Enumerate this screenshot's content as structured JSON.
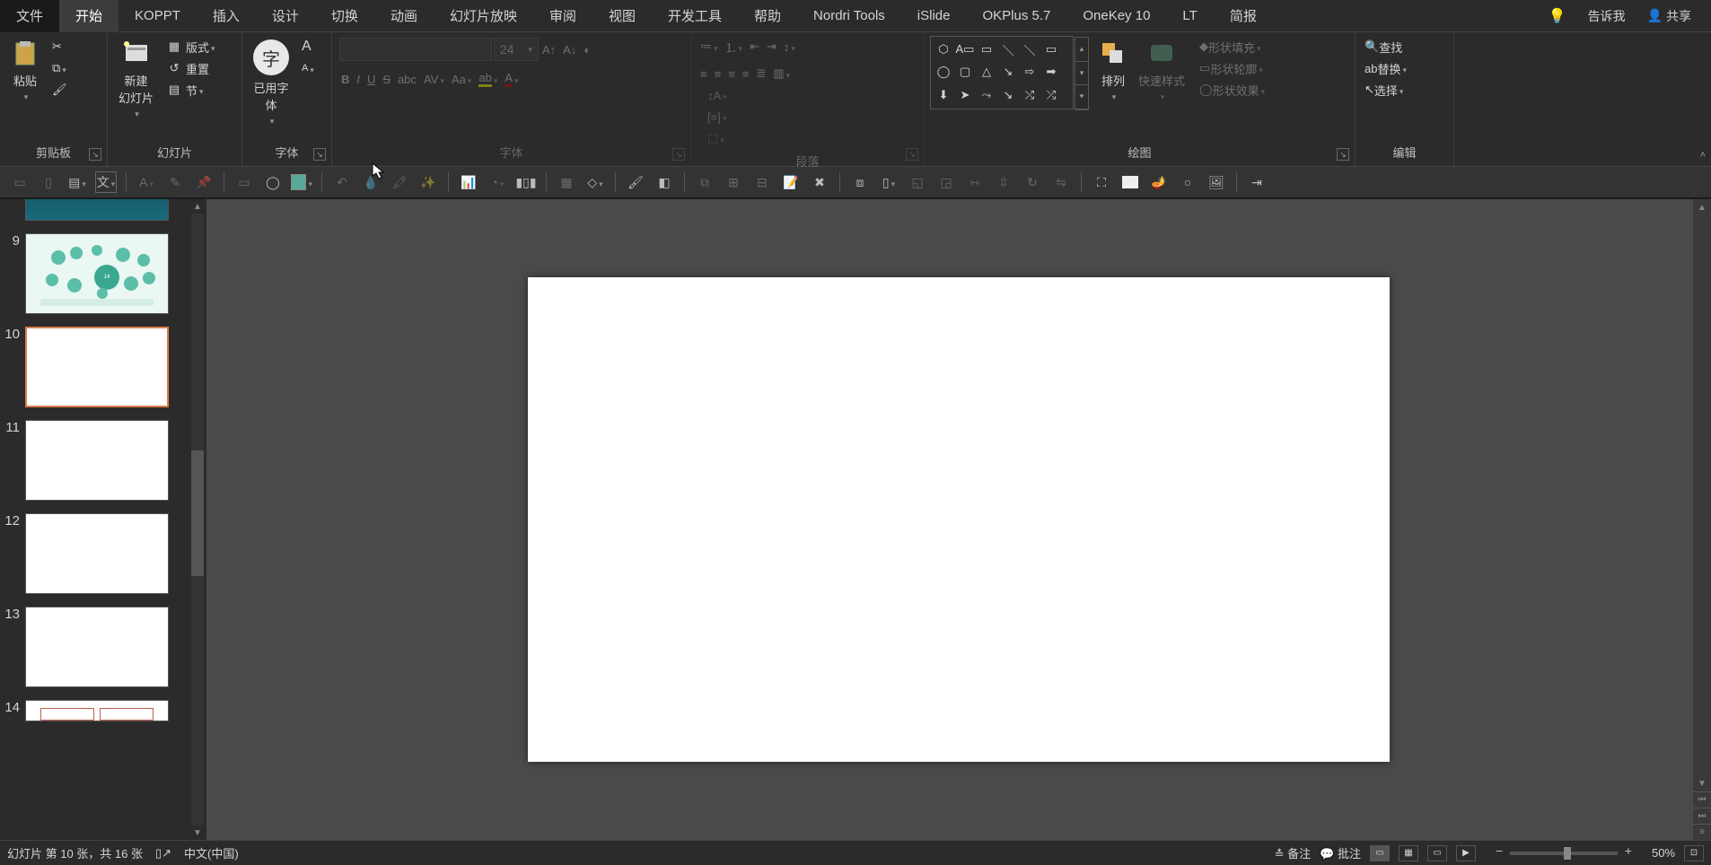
{
  "menu": {
    "file": "文件",
    "home": "开始",
    "tabs": [
      "KOPPT",
      "插入",
      "设计",
      "切换",
      "动画",
      "幻灯片放映",
      "审阅",
      "视图",
      "开发工具",
      "帮助",
      "Nordri Tools",
      "iSlide",
      "OKPlus 5.7",
      "OneKey 10",
      "LT",
      "简报"
    ],
    "tellme": "告诉我",
    "share": "共享"
  },
  "ribbon": {
    "clipboard": {
      "paste": "粘贴",
      "label": "剪贴板"
    },
    "slides": {
      "newslide": "新建\n幻灯片",
      "layout": "版式",
      "reset": "重置",
      "section": "节",
      "label": "幻灯片"
    },
    "usedfont": {
      "btn": "已用字\n体",
      "label": "字体"
    },
    "font": {
      "size": "24",
      "label": "字体"
    },
    "paragraph": {
      "label": "段落"
    },
    "drawing": {
      "arrange": "排列",
      "quickstyle": "快速样式",
      "shapefill": "形状填充",
      "shapeoutline": "形状轮廓",
      "shapeeffects": "形状效果",
      "label": "绘图"
    },
    "editing": {
      "find": "查找",
      "replace": "替换",
      "select": "选择",
      "label": "编辑"
    }
  },
  "slides": {
    "numbers": [
      "9",
      "10",
      "11",
      "12",
      "13",
      "14"
    ],
    "active_index": 1
  },
  "status": {
    "slide_info": "幻灯片 第 10 张，共 16 张",
    "language": "中文(中国)",
    "notes": "备注",
    "comments": "批注",
    "zoom": "50%"
  }
}
